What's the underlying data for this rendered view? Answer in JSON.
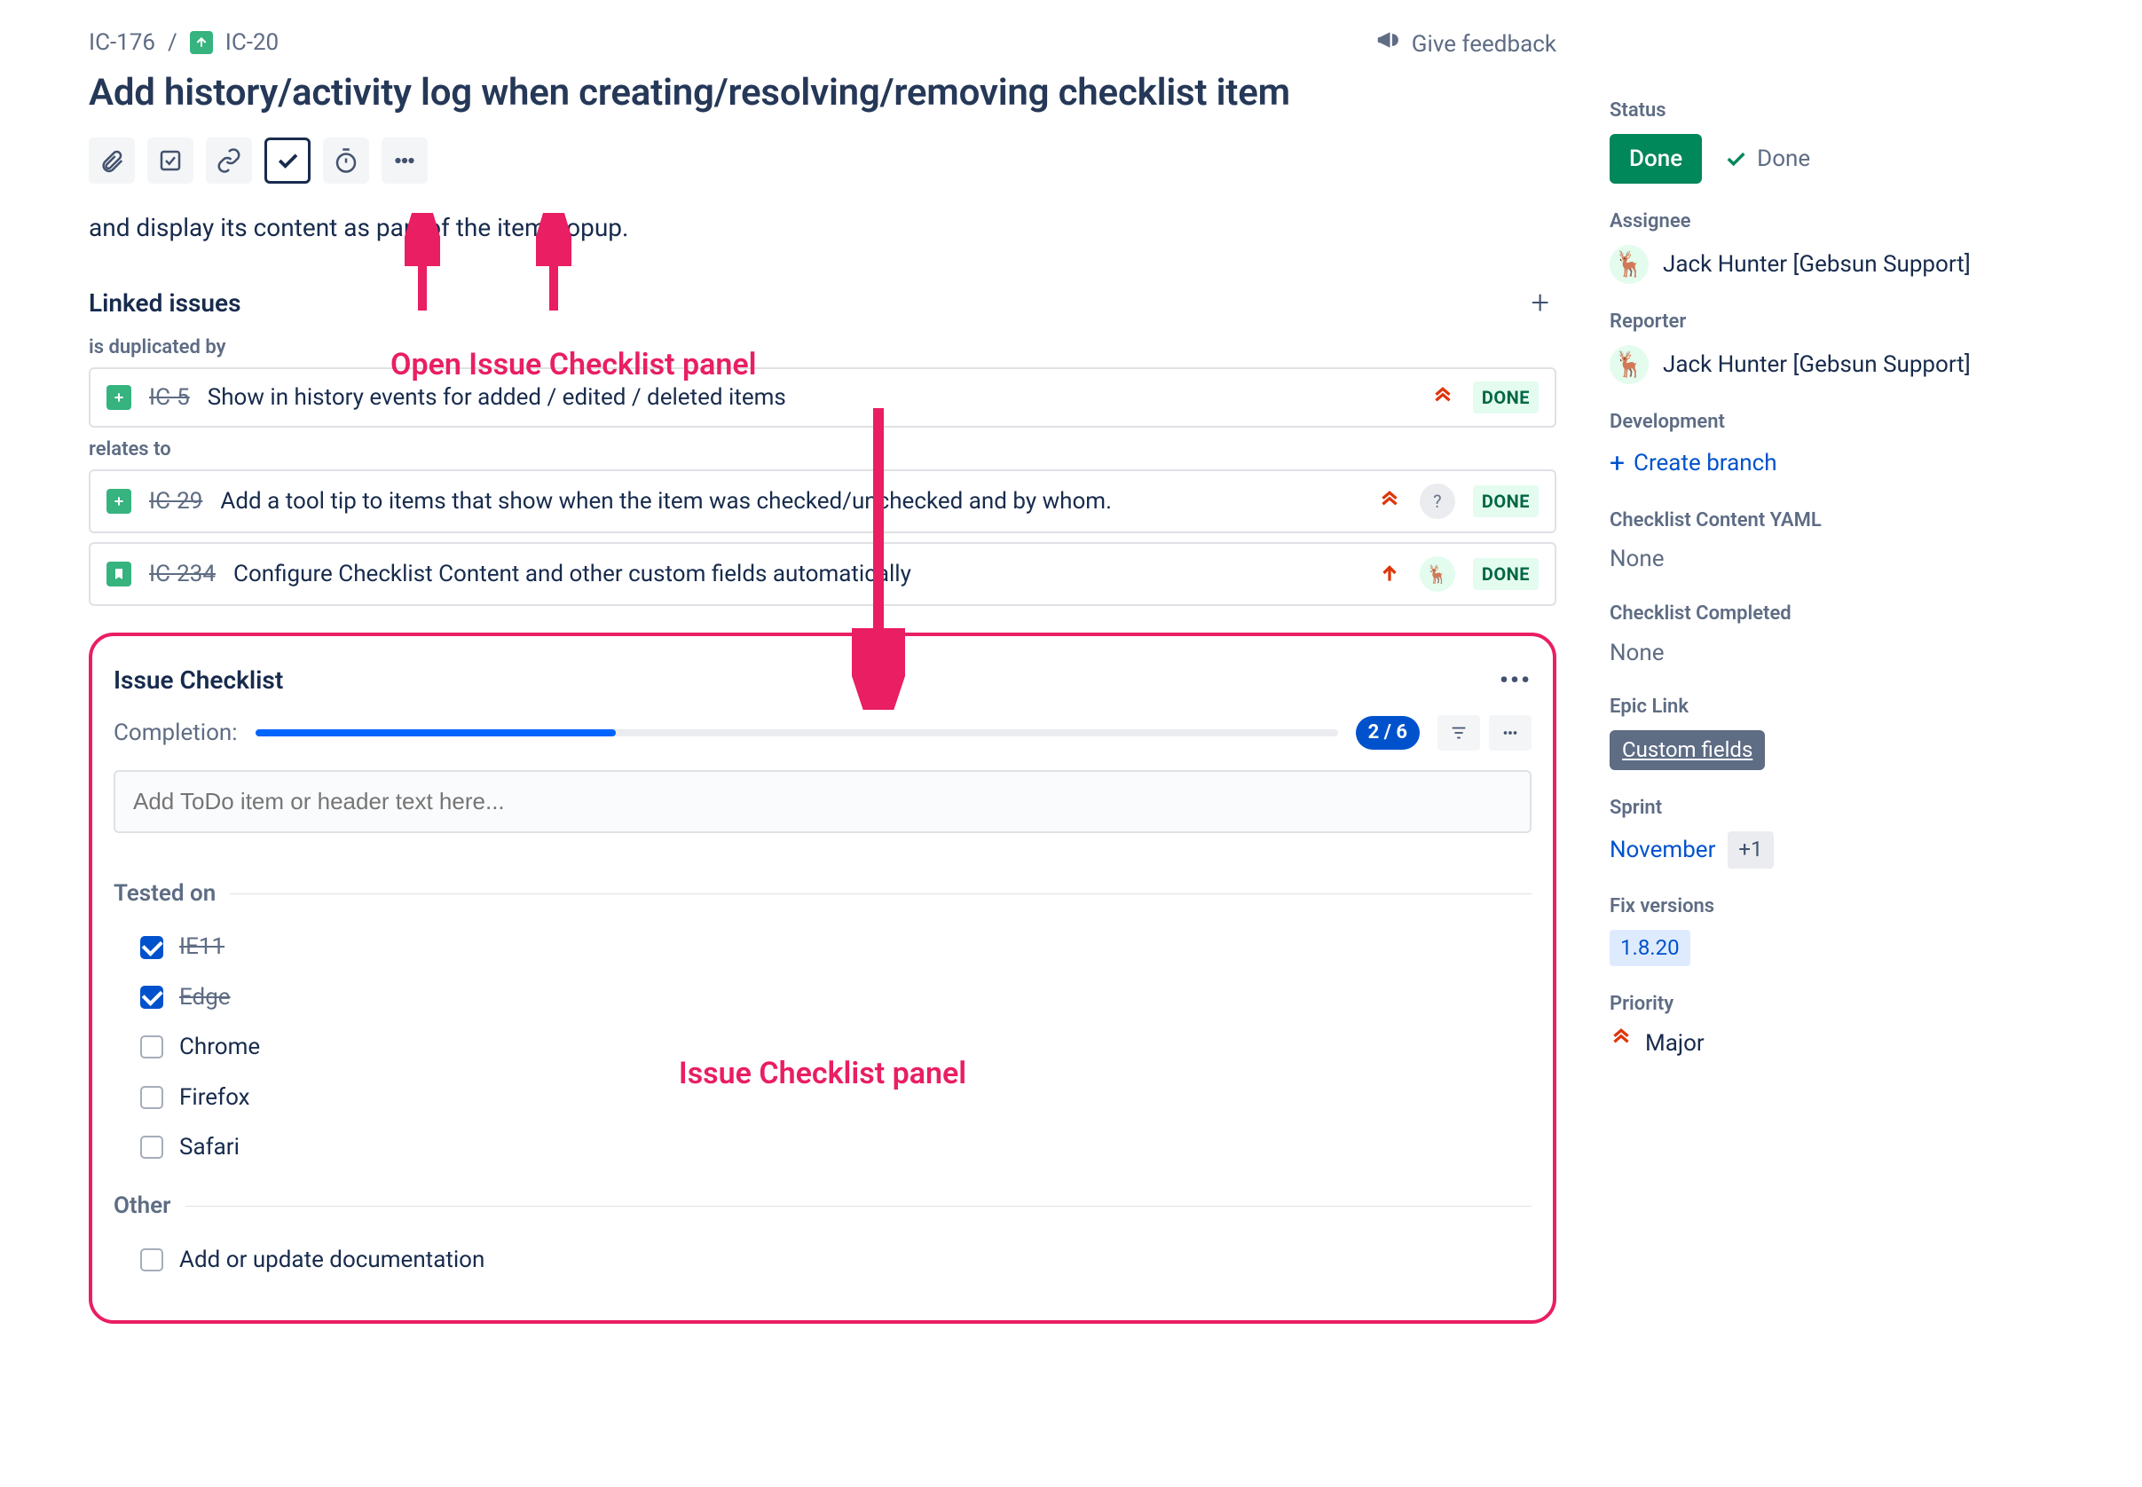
{
  "breadcrumb": {
    "parent_key": "IC-176",
    "child_key": "IC-20"
  },
  "feedback_label": "Give feedback",
  "issue": {
    "title": "Add history/activity log when creating/resolving/removing checklist item",
    "description": "and display its content as part of the item popup."
  },
  "linked_issues": {
    "heading": "Linked issues",
    "groups": [
      {
        "relation": "is duplicated by",
        "items": [
          {
            "key": "IC-5",
            "summary": "Show in history events for added / edited / deleted items",
            "priority": "highest",
            "avatar": null,
            "status": "DONE",
            "type": "new"
          }
        ]
      },
      {
        "relation": "relates to",
        "items": [
          {
            "key": "IC-29",
            "summary": "Add a tool tip to items that show when the item was checked/unchecked and by whom.",
            "priority": "highest",
            "avatar": "unknown",
            "status": "DONE",
            "type": "new"
          },
          {
            "key": "IC-234",
            "summary": "Configure Checklist Content and other custom fields automatically",
            "priority": "high",
            "avatar": "deer",
            "status": "DONE",
            "type": "story"
          }
        ]
      }
    ]
  },
  "checklist": {
    "title": "Issue Checklist",
    "completion_label": "Completion:",
    "done": 2,
    "total": 6,
    "input_placeholder": "Add ToDo item or header text here...",
    "groups": [
      {
        "name": "Tested on",
        "items": [
          {
            "label": "IE11",
            "checked": true
          },
          {
            "label": "Edge",
            "checked": true
          },
          {
            "label": "Chrome",
            "checked": false
          },
          {
            "label": "Firefox",
            "checked": false
          },
          {
            "label": "Safari",
            "checked": false
          }
        ]
      },
      {
        "name": "Other",
        "items": [
          {
            "label": "Add or update documentation",
            "checked": false
          }
        ]
      }
    ]
  },
  "sidebar": {
    "status": {
      "label": "Status",
      "value": "Done",
      "category": "Done"
    },
    "assignee": {
      "label": "Assignee",
      "name": "Jack Hunter [Gebsun Support]"
    },
    "reporter": {
      "label": "Reporter",
      "name": "Jack Hunter [Gebsun Support]"
    },
    "development": {
      "label": "Development",
      "create_branch": "Create branch"
    },
    "yaml": {
      "label": "Checklist Content YAML",
      "value": "None"
    },
    "completed": {
      "label": "Checklist Completed",
      "value": "None"
    },
    "epic": {
      "label": "Epic Link",
      "value": "Custom fields"
    },
    "sprint": {
      "label": "Sprint",
      "value": "November",
      "extra": "+1"
    },
    "fix_versions": {
      "label": "Fix versions",
      "value": "1.8.20"
    },
    "priority": {
      "label": "Priority",
      "value": "Major"
    }
  },
  "annotations": {
    "open_panel": "Open Issue Checklist panel",
    "panel_label": "Issue Checklist panel"
  }
}
